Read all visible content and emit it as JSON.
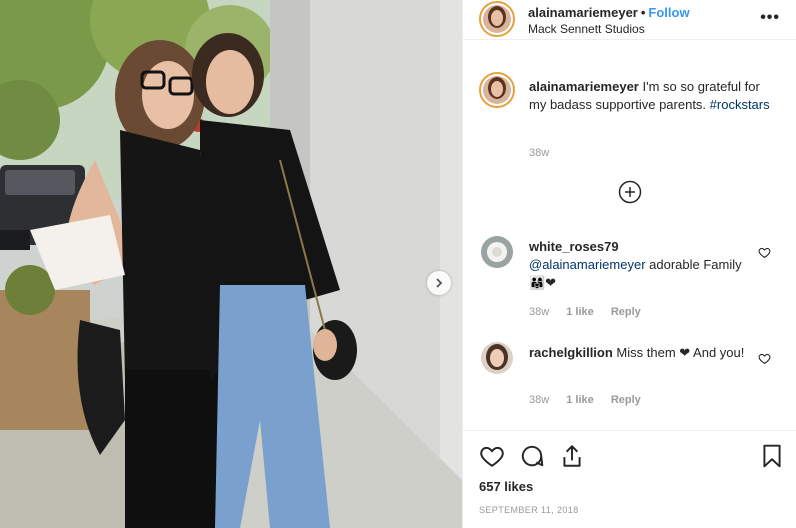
{
  "header": {
    "username": "alainamariemeyer",
    "separator": "•",
    "follow_label": "Follow",
    "location": "Mack Sennett Studios",
    "more_label": "•••"
  },
  "caption": {
    "username": "alainamariemeyer",
    "text": " I'm so so grateful for my badass supportive parents. ",
    "hashtag": "#rockstars",
    "time": "38w"
  },
  "comments": [
    {
      "username": "white_roses79",
      "mention": "@alainamariemeyer",
      "text": " adorable Family 👨‍👩‍👧❤",
      "time": "38w",
      "likes": "1 like",
      "reply_label": "Reply"
    },
    {
      "username": "rachelgkillion",
      "text": " Miss them ❤ And you!",
      "time": "38w",
      "likes": "1 like",
      "reply_label": "Reply"
    }
  ],
  "actions": {
    "likes": "657 likes",
    "date": "SEPTEMBER 11, 2018"
  },
  "icons": {
    "like": "heart-icon",
    "comment": "comment-icon",
    "share": "share-icon",
    "save": "bookmark-icon",
    "load_more": "plus-circle-icon",
    "carousel_next": "chevron-right-icon",
    "more": "ellipsis-icon"
  },
  "colors": {
    "link_blue": "#3897f0",
    "hashtag_dark_blue": "#003569",
    "muted_gray": "#999999",
    "story_ring": "#e8a13a"
  }
}
